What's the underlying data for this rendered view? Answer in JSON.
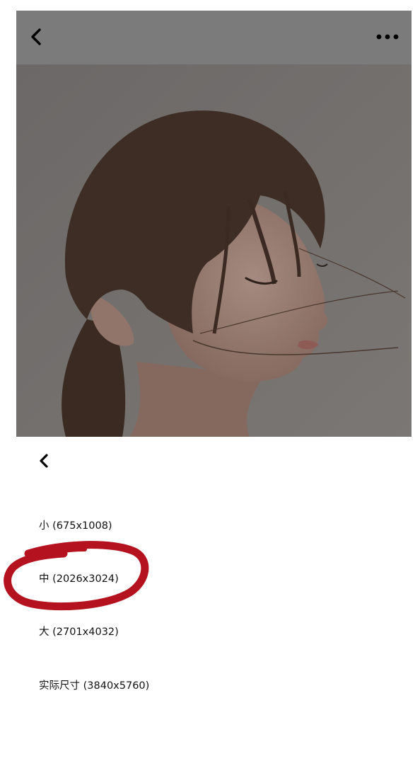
{
  "top_bar": {
    "back_icon": "chevron-left-icon",
    "more_icon": "more-horizontal-icon"
  },
  "photo": {
    "subject": "portrait"
  },
  "size_panel": {
    "back_icon": "chevron-left-icon",
    "options": [
      {
        "label": "小 (675x1008)"
      },
      {
        "label": "中 (2026x3024)"
      },
      {
        "label": "大 (2701x4032)"
      },
      {
        "label": "实际尺寸 (3840x5760)"
      }
    ],
    "highlighted_index": 1
  },
  "colors": {
    "top_bar_bg": "#7b7b7b",
    "annotation_red": "#b3121e",
    "text": "#111111"
  }
}
